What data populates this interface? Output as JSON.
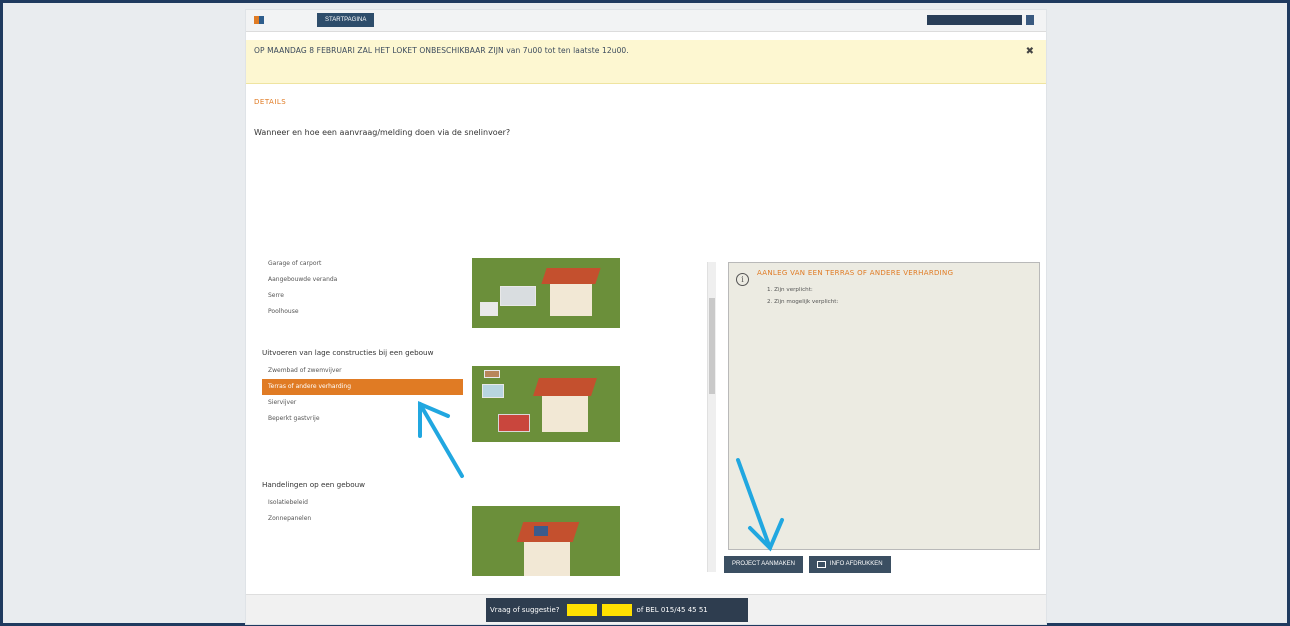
{
  "topbar": {
    "logo_left": "",
    "logo_right": "",
    "start_button": "STARTPAGINA",
    "right_text": "",
    "search_button": ""
  },
  "alert": {
    "title": "OP MAANDAG 8 FEBRUARI ZAL HET LOKET ONBESCHIKBAAR ZIJN van 7u00 tot ten laatste 12u00.",
    "text": "",
    "close": "✖"
  },
  "section": {
    "label": "DETAILS"
  },
  "intro": {
    "heading": "Wanneer en hoe een aanvraag/melding doen via de snelinvoer?",
    "p1": "",
    "p2": "",
    "p3": ""
  },
  "groups": [
    {
      "title": "",
      "items": [
        "Garage of carport",
        "Aangebouwde veranda",
        "Serre",
        "Poolhouse"
      ]
    },
    {
      "title": "Uitvoeren van lage constructies bij een gebouw",
      "items": [
        "Zwembad of zwemvijver",
        "Terras of andere verharding",
        "Siervijver",
        "Beperkt gastvrije"
      ],
      "active_index": 1
    },
    {
      "title": "Handelingen op een gebouw",
      "items": [
        "Isolatiebeleid",
        "Zonnepanelen",
        "",
        ""
      ]
    }
  ],
  "info": {
    "icon": "ⓘ",
    "title": "AANLEG VAN EEN TERRAS OF ANDERE VERHARDING",
    "p1": "",
    "bold": "",
    "bold_link": "",
    "p2": "",
    "list": [
      {
        "label": "1. Zijn verplicht:",
        "sub": [
          "",
          "",
          ""
        ]
      },
      {
        "label": "2. Zijn mogelijk verplicht:",
        "sub": [
          ""
        ]
      }
    ]
  },
  "buttons": {
    "project": "PROJECT AANMAKEN",
    "print": "INFO AFDRUKKEN"
  },
  "footer": {
    "left": "",
    "question": "Vraag of suggestie?",
    "yellow_1": "",
    "yellow_2": "",
    "phone": "of BEL 015/45 45 51",
    "phone_sub": "",
    "right": ""
  },
  "colors": {
    "accent_orange": "#e07b24",
    "annotation_arrow": "#21a7e0",
    "dark_button": "#3b4f62"
  }
}
